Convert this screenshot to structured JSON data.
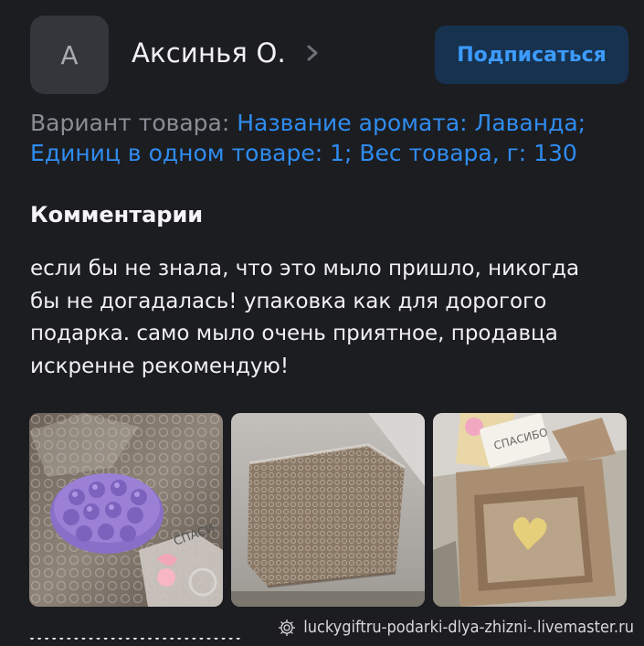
{
  "author": {
    "avatar_letter": "А",
    "name": "Аксинья О."
  },
  "subscribe_label": "Подписаться",
  "variant": {
    "prefix": "Вариант товара:",
    "value": "Название аромата: Лаванда; Единиц в одном товаре: 1; Вес товара, г: 130"
  },
  "comments": {
    "title": "Комментарии",
    "text": "если бы не знала, что это мыло пришло, никогда бы не догадалась! упаковка как для дорогого подарка. само мыло очень приятное, продавца искренне рекомендую!"
  },
  "photos": [
    {
      "icon": "photo-purple-soap-in-bubble-wrap",
      "caption": "СПАСИ"
    },
    {
      "icon": "photo-package-in-bubble-wrap"
    },
    {
      "icon": "photo-open-box-with-thanks-card",
      "caption": "СПАСИБО"
    }
  ],
  "watermark": "luckygiftru-podarki-dlya-zhizni-.livemaster.ru",
  "colors": {
    "background": "#1c1d21",
    "accent": "#2f8cf0",
    "subscribe_bg": "#16324f",
    "muted_text": "#8a8d94"
  }
}
